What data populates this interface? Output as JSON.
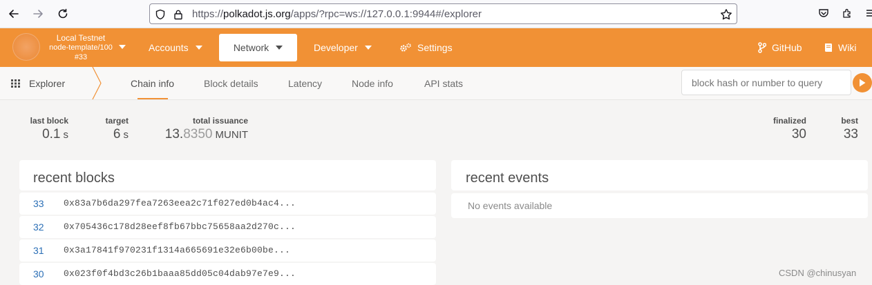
{
  "browser": {
    "url_prefix": "https://",
    "url_domain": "polkadot.js.org",
    "url_rest": "/apps/?rpc=ws://127.0.0.1:9944#/explorer"
  },
  "appbar": {
    "chain_name": "Local Testnet",
    "chain_version": "node-template/100",
    "chain_block": "#33",
    "menu": {
      "accounts": "Accounts",
      "network": "Network",
      "developer": "Developer",
      "settings": "Settings",
      "github": "GitHub",
      "wiki": "Wiki"
    }
  },
  "subnav": {
    "section": "Explorer",
    "tabs": [
      "Chain info",
      "Block details",
      "Latency",
      "Node info",
      "API stats"
    ],
    "query_placeholder": "block hash or number to query"
  },
  "summary": {
    "last_block_label": "last block",
    "last_block_value": "0.1",
    "last_block_unit": "s",
    "target_label": "target",
    "target_value": "6",
    "target_unit": "s",
    "issuance_label": "total issuance",
    "issuance_int": "13.",
    "issuance_frac": "8350",
    "issuance_unit": "MUNIT",
    "finalized_label": "finalized",
    "finalized_value": "30",
    "best_label": "best",
    "best_value": "33"
  },
  "recent_blocks": {
    "title": "recent blocks",
    "rows": [
      {
        "number": "33",
        "hash": "0x83a7b6da297fea7263eea2c71f027ed0b4ac4..."
      },
      {
        "number": "32",
        "hash": "0x705436c178d28eef8fb67bbc75658aa2d270c..."
      },
      {
        "number": "31",
        "hash": "0x3a17841f970231f1314a665691e32e6b00be..."
      },
      {
        "number": "30",
        "hash": "0x023f0f4bd3c26b1baaa85dd05c04dab97e7e9..."
      }
    ]
  },
  "recent_events": {
    "title": "recent events",
    "empty": "No events available"
  },
  "watermark": "CSDN @chinusyan",
  "colors": {
    "accent": "#f19135",
    "link": "#2b6fb6"
  }
}
